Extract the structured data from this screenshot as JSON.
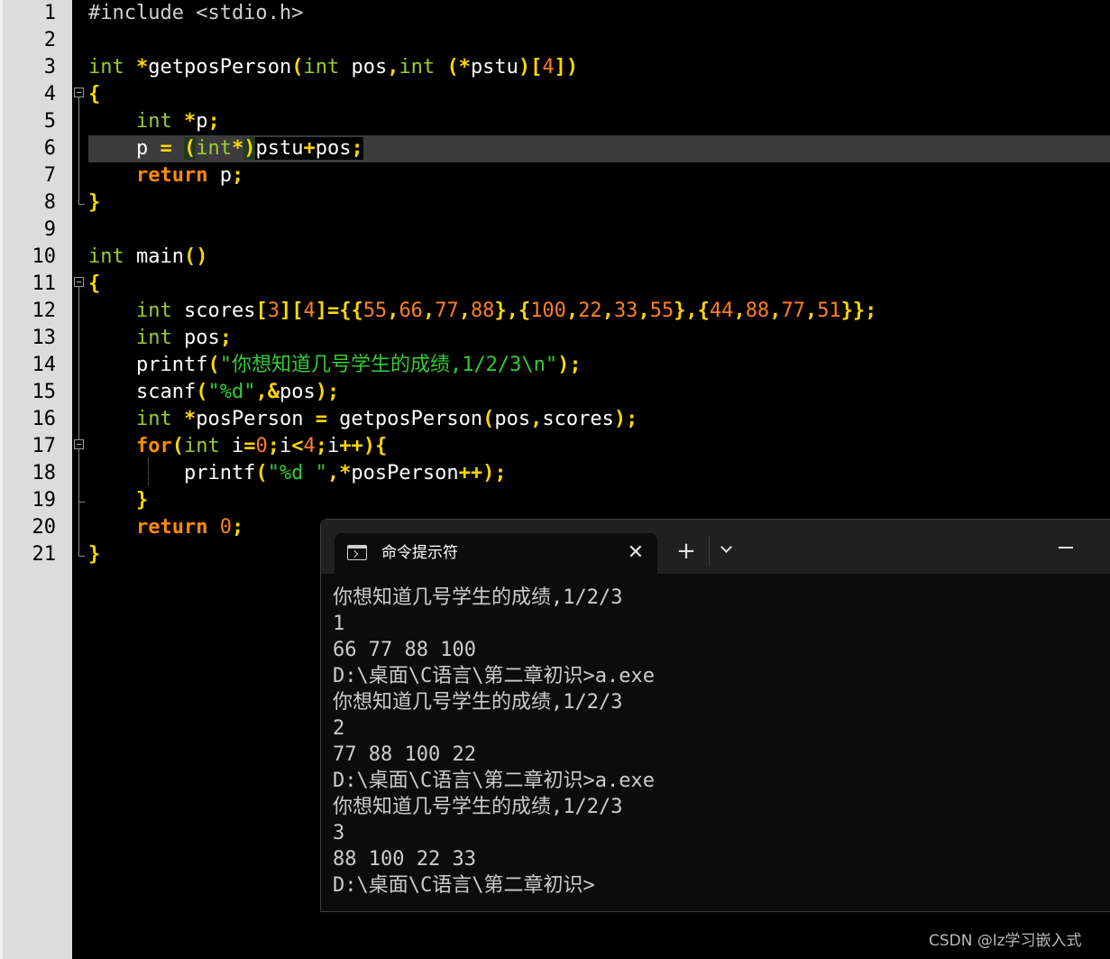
{
  "editor": {
    "line_numbers": [
      "1",
      "2",
      "3",
      "4",
      "5",
      "6",
      "7",
      "8",
      "9",
      "10",
      "11",
      "12",
      "13",
      "14",
      "15",
      "16",
      "17",
      "18",
      "19",
      "20",
      "21"
    ],
    "code": {
      "l1": "#include <stdio.h>",
      "l3": [
        "int",
        " ",
        "*",
        "getposPerson",
        "(",
        "int",
        " pos",
        ",",
        "int",
        " ",
        "(*",
        "pstu",
        ")",
        "[",
        "4",
        "])"
      ],
      "l4": "{",
      "l5": [
        "    ",
        "int",
        " ",
        "*",
        "p",
        ";"
      ],
      "l6": [
        "    p ",
        "=",
        " ",
        "(",
        "int",
        "*",
        ")",
        "pstu",
        "+",
        "pos",
        ";"
      ],
      "l7": [
        "    ",
        "return",
        " p",
        ";"
      ],
      "l8": "}",
      "l10": [
        "int",
        " main",
        "()"
      ],
      "l11": "{",
      "l12": [
        "    ",
        "int",
        " scores",
        "[",
        "3",
        "][",
        "4",
        "]={{",
        "55",
        ",",
        "66",
        ",",
        "77",
        ",",
        "88",
        "},{",
        "100",
        ",",
        "22",
        ",",
        "33",
        ",",
        "55",
        "},{",
        "44",
        ",",
        "88",
        ",",
        "77",
        ",",
        "51",
        "}};"
      ],
      "l13": [
        "    ",
        "int",
        " pos",
        ";"
      ],
      "l14": [
        "    printf",
        "(",
        "\"你想知道几号学生的成绩,1/2/3\\n\"",
        ");"
      ],
      "l15": [
        "    scanf",
        "(",
        "\"%d\"",
        ",&",
        "pos",
        ");"
      ],
      "l16": [
        "    ",
        "int",
        " ",
        "*",
        "posPerson ",
        "=",
        " getposPerson",
        "(",
        "pos",
        ",",
        "scores",
        ");"
      ],
      "l17": [
        "    ",
        "for",
        "(",
        "int",
        " i",
        "=",
        "0",
        ";",
        "i",
        "<",
        "4",
        ";",
        "i",
        "++){"
      ],
      "l18": [
        "        printf",
        "(",
        "\"%d \"",
        ",*",
        "posPerson",
        "++);"
      ],
      "l19": [
        "    ",
        "}"
      ],
      "l20": [
        "    ",
        "return",
        " ",
        "0",
        ";"
      ],
      "l21": "}"
    }
  },
  "terminal": {
    "tab_title": "命令提示符",
    "close_icon": "close-icon",
    "new_tab_label": "+",
    "output_lines": [
      "你想知道几号学生的成绩,1/2/3",
      "1",
      "66 77 88 100",
      "D:\\桌面\\C语言\\第二章初识>a.exe",
      "你想知道几号学生的成绩,1/2/3",
      "2",
      "77 88 100 22",
      "D:\\桌面\\C语言\\第二章初识>a.exe",
      "你想知道几号学生的成绩,1/2/3",
      "3",
      "88 100 22 33",
      "D:\\桌面\\C语言\\第二章初识>"
    ]
  },
  "watermark": "CSDN @lz学习嵌入式",
  "colors": {
    "keyword": "#9acd32",
    "control": "#ff8c00",
    "punct": "#ffd700",
    "number": "#ff7f24",
    "string": "#32cd32",
    "gutter": "#dcdcdc",
    "terminal_bg": "#0c0c0c"
  }
}
